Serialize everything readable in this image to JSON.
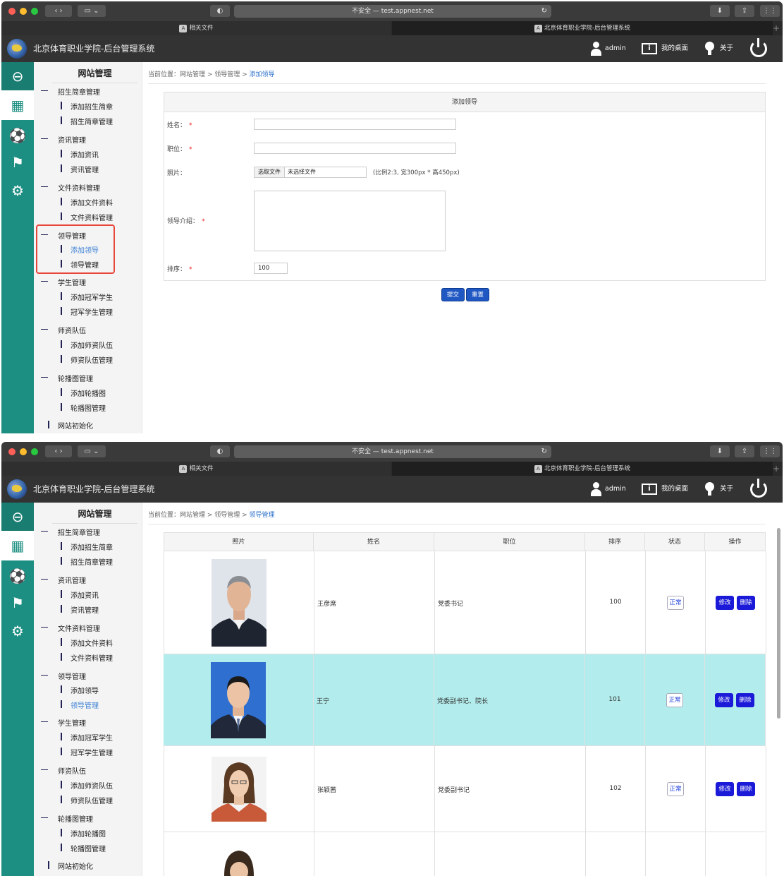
{
  "browser": {
    "address": "不安全 — test.appnest.net",
    "tab1": "相关文件",
    "tab2": "北京体育职业学院-后台管理系统",
    "tab_icon": "A"
  },
  "app": {
    "title": "北京体育职业学院-后台管理系统",
    "user": "admin",
    "desktop": "我的桌面",
    "about": "关于"
  },
  "menu": {
    "title": "网站管理",
    "groups": [
      {
        "label": "招生简章管理",
        "items": [
          "添加招生简章",
          "招生简章管理"
        ]
      },
      {
        "label": "资讯管理",
        "items": [
          "添加资讯",
          "资讯管理"
        ]
      },
      {
        "label": "文件资料管理",
        "items": [
          "添加文件资料",
          "文件资料管理"
        ]
      },
      {
        "label": "领导管理",
        "items": [
          "添加领导",
          "领导管理"
        ]
      },
      {
        "label": "学生管理",
        "items": [
          "添加冠军学生",
          "冠军学生管理"
        ]
      },
      {
        "label": "师资队伍",
        "items": [
          "添加师资队伍",
          "师资队伍管理"
        ]
      },
      {
        "label": "轮播图管理",
        "items": [
          "添加轮播图",
          "轮播图管理"
        ]
      }
    ],
    "init": "网站初始化"
  },
  "screen1": {
    "crumb_prefix": "当前位置：网站管理 > 领导管理 > ",
    "crumb_current": "添加领导",
    "form": {
      "title": "添加领导",
      "name_label": "姓名：",
      "position_label": "职位：",
      "photo_label": "照片：",
      "file_button": "选取文件",
      "file_none": "未选择文件",
      "photo_hint": "(比例2:3, 宽300px * 高450px)",
      "intro_label": "领导介绍：",
      "sort_label": "排序：",
      "sort_value": "100",
      "submit": "提交",
      "reset": "重置",
      "required_mark": "*"
    }
  },
  "screen2": {
    "crumb_prefix": "当前位置：网站管理 > 领导管理 > ",
    "crumb_current": "领导管理",
    "table": {
      "headers": [
        "照片",
        "姓名",
        "职位",
        "排序",
        "状态",
        "操作"
      ],
      "rows": [
        {
          "name": "王彦席",
          "position": "党委书记",
          "sort": "100",
          "status": "正常"
        },
        {
          "name": "王宁",
          "position": "党委副书记、院长",
          "sort": "101",
          "status": "正常"
        },
        {
          "name": "张颖茜",
          "position": "党委副书记",
          "sort": "102",
          "status": "正常"
        }
      ],
      "edit": "修改",
      "delete": "删除"
    }
  },
  "colors": {
    "rail": "#1d8f82",
    "selected_row": "#b3ecec",
    "primary_button": "#1f57c3",
    "highlight_box": "#e8463a"
  }
}
